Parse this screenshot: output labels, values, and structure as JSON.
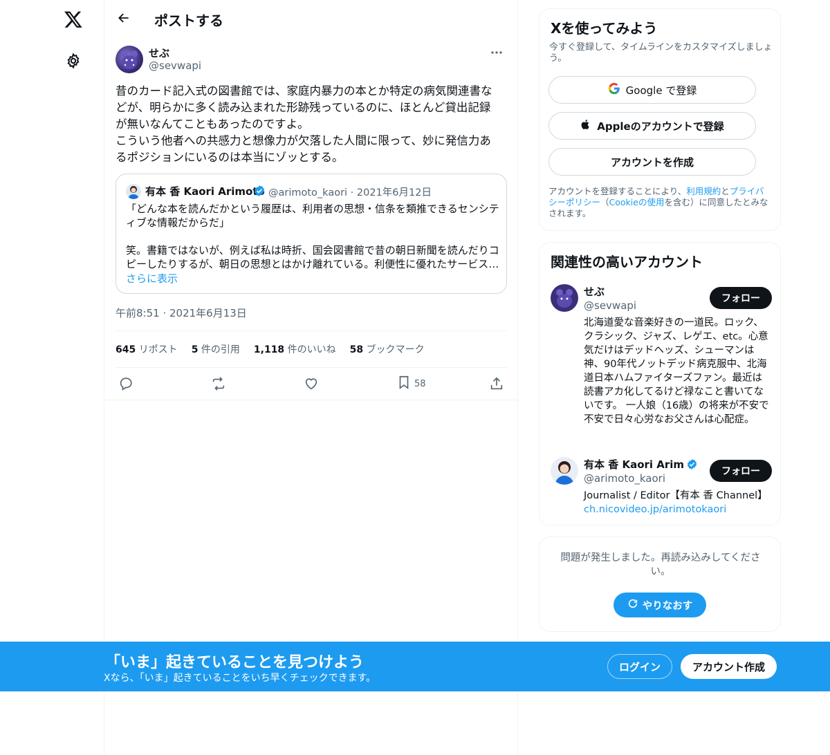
{
  "header": {
    "title": "ポストする"
  },
  "tweet": {
    "author_name": "せぶ",
    "author_handle": "@sevwapi",
    "text": "昔のカード記入式の図書館では、家庭内暴力の本とか特定の病気関連書な\nどが、明らかに多く読み込まれた形跡残っているのに、ほとんど貸出記録\nが無いなんてこともあったのですよ。\nこういう他者への共感力と想像力が欠落した人間に限って、妙に発信力あ\nるポジションにいるのは本当にゾッとする。",
    "timestamp": "午前8:51 · 2021年6月13日",
    "stats": {
      "reposts_count": "645",
      "reposts_label": "リポスト",
      "quotes_count": "5",
      "quotes_label": "件の引用",
      "likes_count": "1,118",
      "likes_label": "件のいいね",
      "bookmarks_count": "58",
      "bookmarks_label": "ブックマーク"
    },
    "bookmark_action_count": "58"
  },
  "quote": {
    "author_name": "有本 香 Kaori Arimoto",
    "meta": "@arimoto_kaori · 2021年6月12日",
    "text": "「どんな本を読んだかという履歴は、利用者の思想・信条を類推できるセンシテ\nィブな情報だからだ」\n\n笑。書籍ではないが、例えば私は時折、国会図書館で昔の朝日新聞を読んだりコ\nピーしたりするが、朝日の思想とはかけ離れている。利便性に優れたサービス…",
    "show_more": "さらに表示"
  },
  "signup_card": {
    "title": "Xを使ってみよう",
    "subtitle": "今すぐ登録して、タイムラインをカスタマイズしましょう。",
    "google_label": "Google で登録",
    "apple_label": "Appleのアカウントで登録",
    "create_label": "アカウントを作成",
    "legal_prefix": "アカウントを登録することにより、",
    "legal_terms": "利用規約",
    "legal_and": "と",
    "legal_privacy": "プライバシーポリシー",
    "legal_paren_open": "（",
    "legal_cookie": "Cookieの使用",
    "legal_suffix": "を含む）に同意したとみなされます。"
  },
  "related": {
    "title": "関連性の高いアカウント",
    "accounts": [
      {
        "name": "せぶ",
        "handle": "@sevwapi",
        "follow": "フォロー",
        "bio": "北海道愛な音楽好きの一道民。ロック、クラシック、ジャズ、レゲエ、etc。心意気だけはデッドヘッズ、シューマンは神、90年代ノットデッド病克服中、北海道日本ハムファイターズファン。最近は読書アカ化してるけど禄なこと書いてないです。 一人娘（16歳）の将来が不安で不安で日々心労なお父さんは心配症。"
      },
      {
        "name": "有本 香 Kaori Arimot",
        "handle": "@arimoto_kaori",
        "follow": "フォロー",
        "bio": "Journalist / Editor【有本 香 Channel】",
        "link": "ch.nicovideo.jp/arimotokaori"
      }
    ]
  },
  "error_card": {
    "message": "問題が発生しました。再読み込みしてください。",
    "retry": "やりなおす"
  },
  "banner": {
    "title": "「いま」起きていることを見つけよう",
    "subtitle": "Xなら、「いま」起きていることをいち早くチェックできます。",
    "login": "ログイン",
    "signup": "アカウント作成"
  },
  "colors": {
    "accent": "#1d9bf0",
    "text": "#0f1419",
    "muted": "#536471"
  }
}
